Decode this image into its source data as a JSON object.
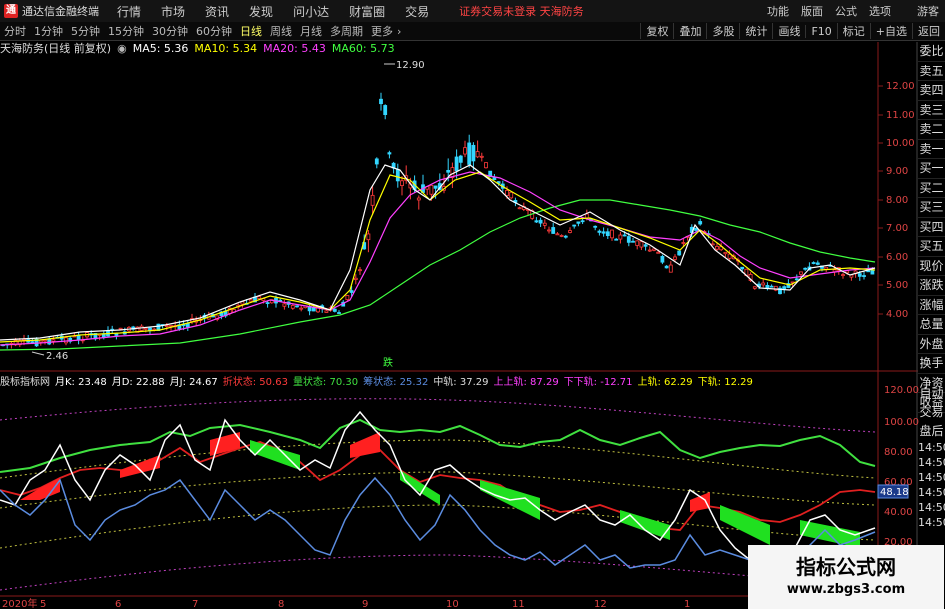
{
  "menubar": {
    "app_name": "通达信金融终端",
    "items": [
      "行情",
      "市场",
      "资讯",
      "发现",
      "问小达",
      "财富圈",
      "交易"
    ],
    "notice": "证券交易未登录  天海防务",
    "right_items": [
      "功能",
      "版面",
      "公式",
      "选项",
      "游客"
    ]
  },
  "toolbar": {
    "periods": [
      "分时",
      "1分钟",
      "5分钟",
      "15分钟",
      "30分钟",
      "60分钟",
      "日线",
      "周线",
      "月线",
      "多周期",
      "更多"
    ],
    "active_period": "日线",
    "tools": [
      "复权",
      "叠加",
      "多股",
      "统计",
      "画线",
      "F10",
      "标记",
      "+自选",
      "返回"
    ]
  },
  "infobar": {
    "stock": "天海防务(日线 前复权)",
    "ma5": "MA5: 5.36",
    "ma10": "MA10: 5.34",
    "ma20": "MA20: 5.43",
    "ma60": "MA60: 5.73"
  },
  "price_axis": [
    "12.00",
    "11.00",
    "10.00",
    "9.00",
    "8.00",
    "7.00",
    "6.00",
    "5.00",
    "4.00"
  ],
  "annotations": {
    "high": "12.90",
    "low": "2.46",
    "signal": "跌"
  },
  "indicator_bar": {
    "name": "股标指标网",
    "k": "月K: 23.48",
    "d": "月D: 22.88",
    "j": "月J: 24.67",
    "s1": "折状态: 50.63",
    "s2": "量状态: 70.30",
    "s3": "筹状态: 25.32",
    "mid": "中轨: 37.29",
    "up2": "上上轨: 87.29",
    "down2": "下下轨: -12.71",
    "up": "上轨: 62.29",
    "down": "下轨: 12.29"
  },
  "ind_axis": [
    "120.00",
    "100.00",
    "80.00",
    "60.00",
    "40.00",
    "20.00"
  ],
  "ind_value_badge": "48.18",
  "side_buttons": [
    "委比",
    "卖五",
    "卖四",
    "卖三",
    "卖二",
    "卖一",
    "买一",
    "买二",
    "买三",
    "买四",
    "买五",
    "现价",
    "涨跌",
    "涨幅",
    "总量",
    "外盘",
    "换手",
    "净资",
    "收益"
  ],
  "side_buttons2": [
    "自动",
    "交易",
    "盘后"
  ],
  "side_times": [
    "14:50",
    "14:50",
    "14:50",
    "14:50",
    "14:50",
    "14:50"
  ],
  "x_axis": [
    "2020年",
    "5",
    "6",
    "7",
    "8",
    "9",
    "10",
    "11",
    "12",
    "1"
  ],
  "watermark": {
    "title": "指标公式网",
    "url": "www.zbgs3.com"
  },
  "colors": {
    "up": "#ff3b3b",
    "down": "#33d6ff",
    "ma5": "#ffffff",
    "ma10": "#ffff00",
    "ma20": "#ff40ff",
    "ma60": "#40ff40"
  }
}
